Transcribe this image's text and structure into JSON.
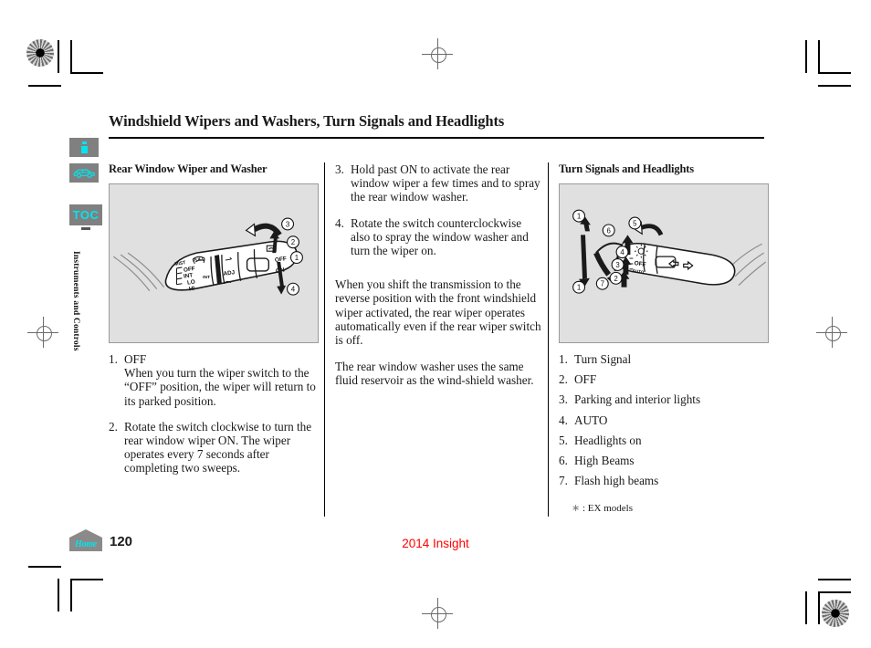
{
  "document": {
    "page_title": "Windshield Wipers and Washers, Turn Signals and Headlights",
    "page_number": "120",
    "model_line": "2014 Insight",
    "section_label": "Instruments and Controls"
  },
  "sidebar": {
    "info_icon": "info-icon",
    "car_icon": "car-icon",
    "toc_label": "TOC",
    "home_label": "Home"
  },
  "column1": {
    "heading": "Rear Window Wiper and Washer",
    "items": [
      {
        "index": "1.",
        "text": "OFF\nWhen you turn the wiper switch to the “OFF” position, the wiper will return to its parked position."
      },
      {
        "index": "2.",
        "text": "Rotate the switch clockwise to turn the rear window wiper ON. The wiper operates every 7 seconds after completing two sweeps."
      }
    ]
  },
  "column2": {
    "items": [
      {
        "index": "3.",
        "text": "Hold past ON to activate the rear window wiper a few times and to spray the rear window washer."
      },
      {
        "index": "4.",
        "text": "Rotate the switch counterclockwise also to spray the window washer and turn the wiper on."
      }
    ],
    "paragraphs": [
      "When you shift the transmission to the reverse position with the front windshield wiper activated, the rear wiper operates automatically even if the rear wiper switch is off.",
      "The rear window washer uses the same fluid reservoir as the wind-shield washer."
    ]
  },
  "column3": {
    "heading": "Turn Signals and Headlights",
    "items": [
      {
        "index": "1.",
        "text": "Turn Signal"
      },
      {
        "index": "2.",
        "text": "OFF"
      },
      {
        "index": "3.",
        "text": "Parking and interior lights"
      },
      {
        "index": "4.",
        "text": "AUTO"
      },
      {
        "index": "5.",
        "text": "Headlights on"
      },
      {
        "index": "6.",
        "text": "High Beams"
      },
      {
        "index": "7.",
        "text": "Flash high beams"
      }
    ],
    "footnote_marker": "∗",
    "footnote": ": EX models"
  },
  "figure_wiper": {
    "name": "rear-window-wiper-stalk-diagram",
    "labels": [
      "MIST",
      "PULL",
      "OFF",
      "INT",
      "LO",
      "HI",
      "ADJ",
      "OFF",
      "ON"
    ],
    "callouts": [
      "1",
      "2",
      "3",
      "4"
    ]
  },
  "figure_turn": {
    "name": "turn-signal-headlight-stalk-diagram",
    "labels": [
      "OFF",
      "AUTO"
    ],
    "callouts": [
      "1",
      "2",
      "3",
      "4",
      "5",
      "6",
      "7"
    ]
  },
  "colors": {
    "accent_cyan": "#00e5ee",
    "model_red": "#ff0000",
    "figure_bg": "#e0e0e0",
    "button_gray": "#808080"
  }
}
